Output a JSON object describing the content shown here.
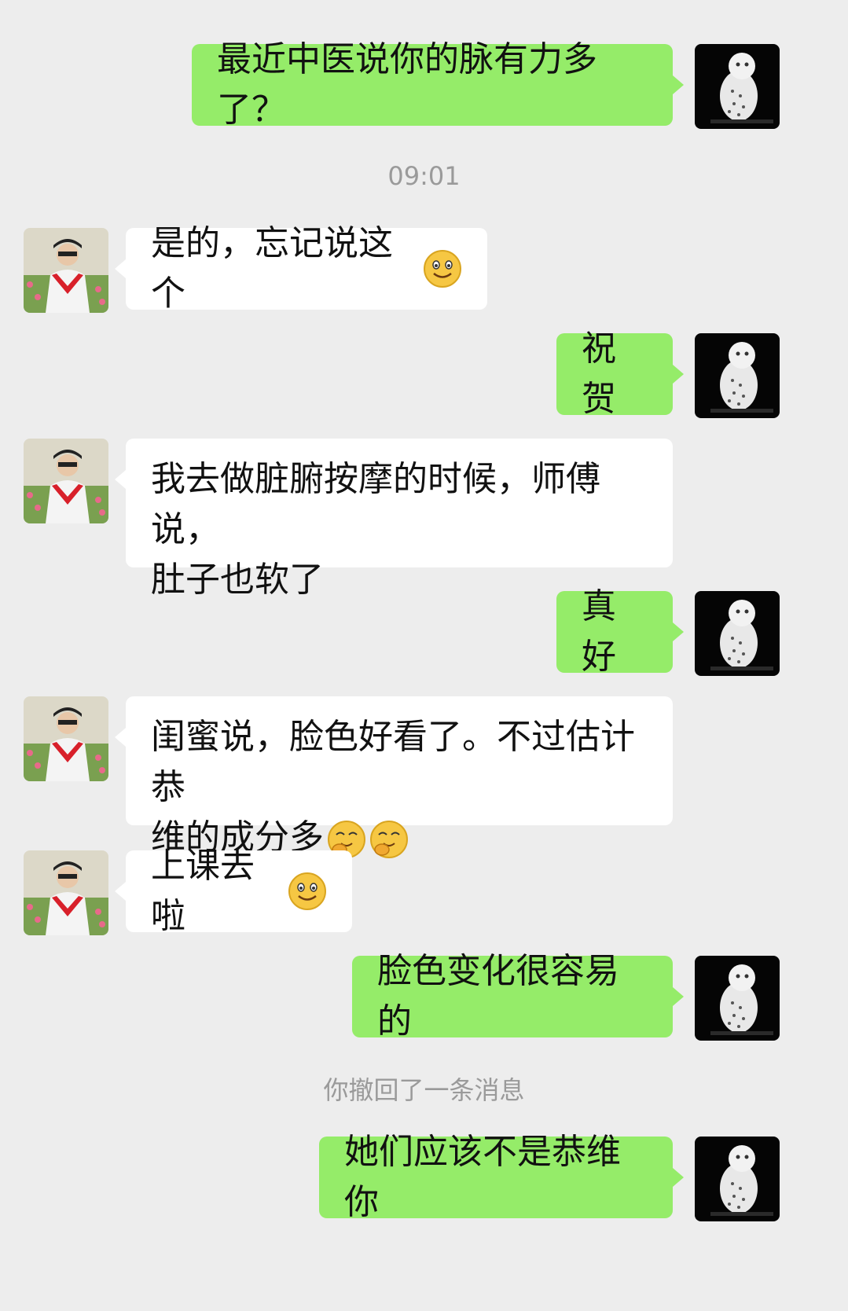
{
  "chat": {
    "messages": [
      {
        "side": "out",
        "text": "最近中医说你的脉有力多了？"
      },
      {
        "side": "system",
        "text": "09:01"
      },
      {
        "side": "in",
        "text": "是的，忘记说这个",
        "emoji": [
          "smile-emoji"
        ]
      },
      {
        "side": "out",
        "text": "祝贺"
      },
      {
        "side": "in",
        "lines": [
          "我去做脏腑按摩的时候，师傅说，",
          "肚子也软了"
        ]
      },
      {
        "side": "out",
        "text": "真好"
      },
      {
        "side": "in",
        "lines": [
          "闺蜜说，脸色好看了。不过估计恭",
          "维的成分多"
        ],
        "emoji": [
          "giggle-emoji",
          "giggle-emoji"
        ]
      },
      {
        "side": "in",
        "text": "上课去啦",
        "emoji": [
          "smile-emoji"
        ]
      },
      {
        "side": "out",
        "text": "脸色变化很容易的"
      },
      {
        "side": "system",
        "text": "你撤回了一条消息"
      },
      {
        "side": "out",
        "text": "她们应该不是恭维你"
      }
    ]
  },
  "avatars": {
    "self": "owl-avatar",
    "contact": "woman-avatar"
  },
  "colors": {
    "background": "#ededed",
    "outgoing_bubble": "#95ec69",
    "incoming_bubble": "#ffffff",
    "system_text": "#9a9a9a"
  }
}
